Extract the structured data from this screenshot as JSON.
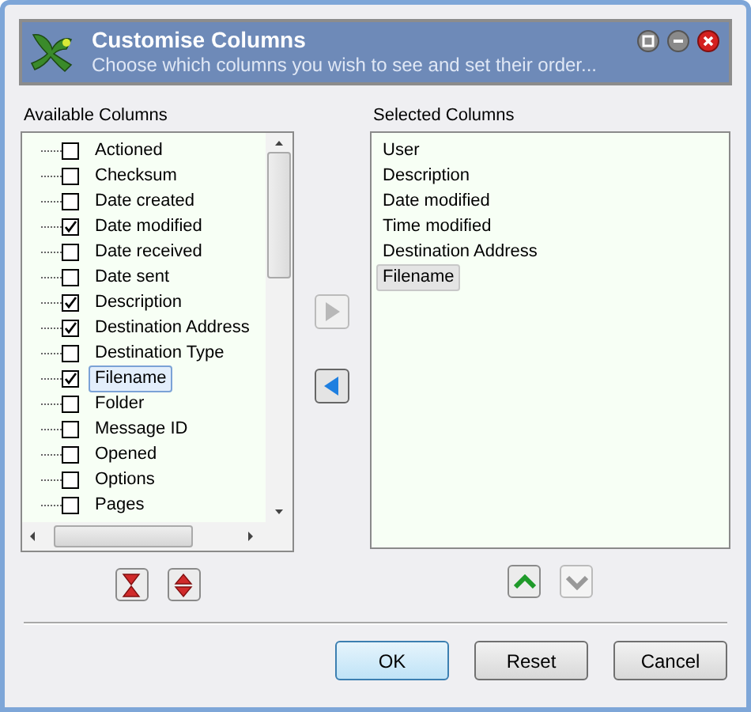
{
  "header": {
    "title": "Customise Columns",
    "subtitle": "Choose which columns you wish to see and set their order..."
  },
  "available": {
    "label": "Available Columns",
    "items": [
      {
        "label": "Actioned",
        "checked": false,
        "selected": false
      },
      {
        "label": "Checksum",
        "checked": false,
        "selected": false
      },
      {
        "label": "Date created",
        "checked": false,
        "selected": false
      },
      {
        "label": "Date modified",
        "checked": true,
        "selected": false
      },
      {
        "label": "Date received",
        "checked": false,
        "selected": false
      },
      {
        "label": "Date sent",
        "checked": false,
        "selected": false
      },
      {
        "label": "Description",
        "checked": true,
        "selected": false
      },
      {
        "label": "Destination Address",
        "checked": true,
        "selected": false
      },
      {
        "label": "Destination Type",
        "checked": false,
        "selected": false
      },
      {
        "label": "Filename",
        "checked": true,
        "selected": true
      },
      {
        "label": "Folder",
        "checked": false,
        "selected": false
      },
      {
        "label": "Message ID",
        "checked": false,
        "selected": false
      },
      {
        "label": "Opened",
        "checked": false,
        "selected": false
      },
      {
        "label": "Options",
        "checked": false,
        "selected": false
      },
      {
        "label": "Pages",
        "checked": false,
        "selected": false
      }
    ]
  },
  "transfer": {
    "add_disabled": true,
    "remove_disabled": false
  },
  "selected_columns": {
    "label": "Selected Columns",
    "items": [
      {
        "label": "User",
        "selected": false
      },
      {
        "label": "Description",
        "selected": false
      },
      {
        "label": "Date modified",
        "selected": false
      },
      {
        "label": "Time modified",
        "selected": false
      },
      {
        "label": "Destination Address",
        "selected": false
      },
      {
        "label": "Filename",
        "selected": true
      }
    ]
  },
  "order": {
    "up_disabled": false,
    "down_disabled": true
  },
  "buttons": [
    {
      "label": "OK",
      "default": true
    },
    {
      "label": "Reset",
      "default": false
    },
    {
      "label": "Cancel",
      "default": false
    }
  ]
}
